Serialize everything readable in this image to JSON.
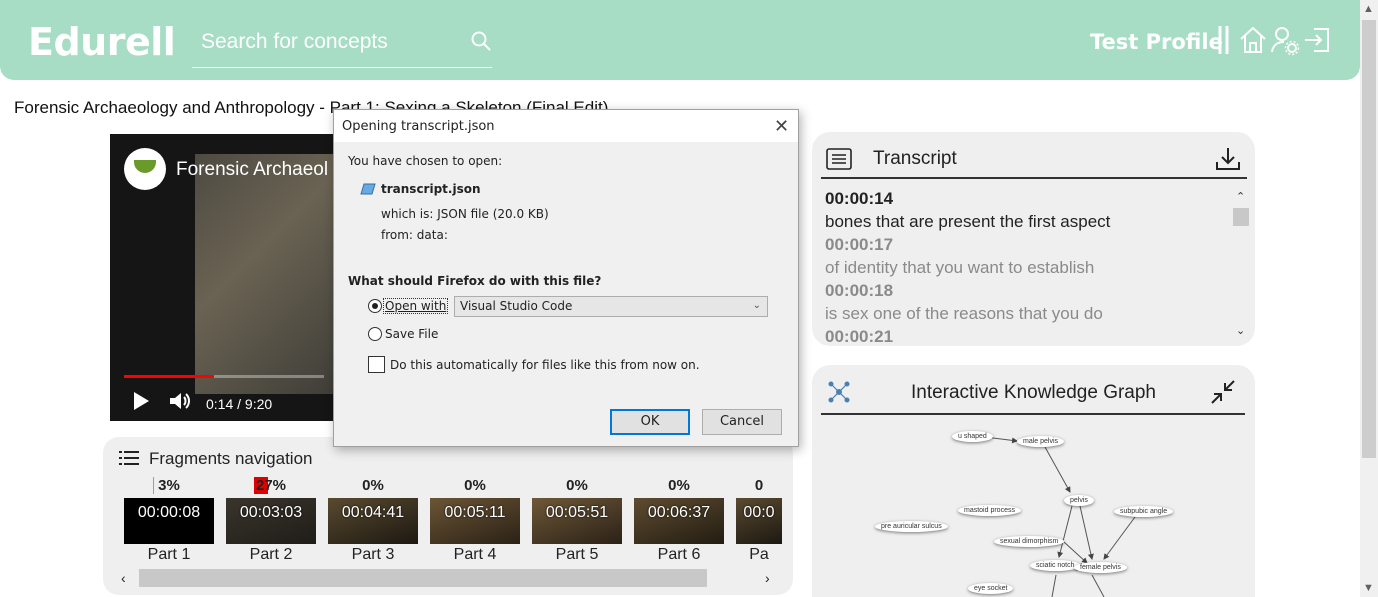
{
  "header": {
    "logo": "Edurell",
    "search_placeholder": "Search for concepts",
    "profile_name": "Test Profile",
    "colors": {
      "background": "#a6ddc4",
      "text": "#ffffff"
    },
    "icons": [
      "divider-icon",
      "home-icon",
      "user-settings-icon",
      "logout-icon"
    ]
  },
  "video": {
    "page_title": "Forensic Archaeology and Anthropology - Part 1: Sexing a Skeleton (Final Edit)",
    "overlay_title": "Forensic Archaeol",
    "time": "0:14 / 9:20",
    "progress": 0.45
  },
  "fragments": {
    "title": "Fragments navigation",
    "items": [
      {
        "percent": "3%",
        "time": "00:00:08",
        "part": "Part 1"
      },
      {
        "percent": "27%",
        "time": "00:03:03",
        "part": "Part 2"
      },
      {
        "percent": "0%",
        "time": "00:04:41",
        "part": "Part 3"
      },
      {
        "percent": "0%",
        "time": "00:05:11",
        "part": "Part 4"
      },
      {
        "percent": "0%",
        "time": "00:05:51",
        "part": "Part 5"
      },
      {
        "percent": "0%",
        "time": "00:06:37",
        "part": "Part 6"
      },
      {
        "percent": "0",
        "time": "00:0",
        "part": "Pa"
      }
    ]
  },
  "transcript": {
    "title": "Transcript",
    "entries": [
      {
        "time": "00:00:14",
        "text": "bones that are present the first aspect",
        "active": true
      },
      {
        "time": "00:00:17",
        "text": "of identity that you want to establish",
        "active": false
      },
      {
        "time": "00:00:18",
        "text": "is sex one of the reasons that you do",
        "active": false
      },
      {
        "time": "00:00:21",
        "text": "",
        "active": false
      }
    ]
  },
  "knowledge_graph": {
    "title": "Interactive Knowledge Graph",
    "nodes": [
      "u shaped",
      "male pelvis",
      "pelvis",
      "subpubic angle",
      "mastoid process",
      "pre auricular sulcus",
      "sexual dimorphism",
      "sciatic notch",
      "female pelvis",
      "eye socket"
    ]
  },
  "dialog": {
    "title": "Opening transcript.json",
    "intro": "You have chosen to open:",
    "filename": "transcript.json",
    "which_is": "which is:  JSON file (20.0 KB)",
    "from": "from:  data:",
    "question": "What should Firefox do with this file?",
    "open_with_label": "Open with",
    "open_with_app": "Visual Studio Code",
    "save_file_label": "Save File",
    "auto_label": "Do this automatically for files like this from now on.",
    "ok": "OK",
    "cancel": "Cancel"
  }
}
